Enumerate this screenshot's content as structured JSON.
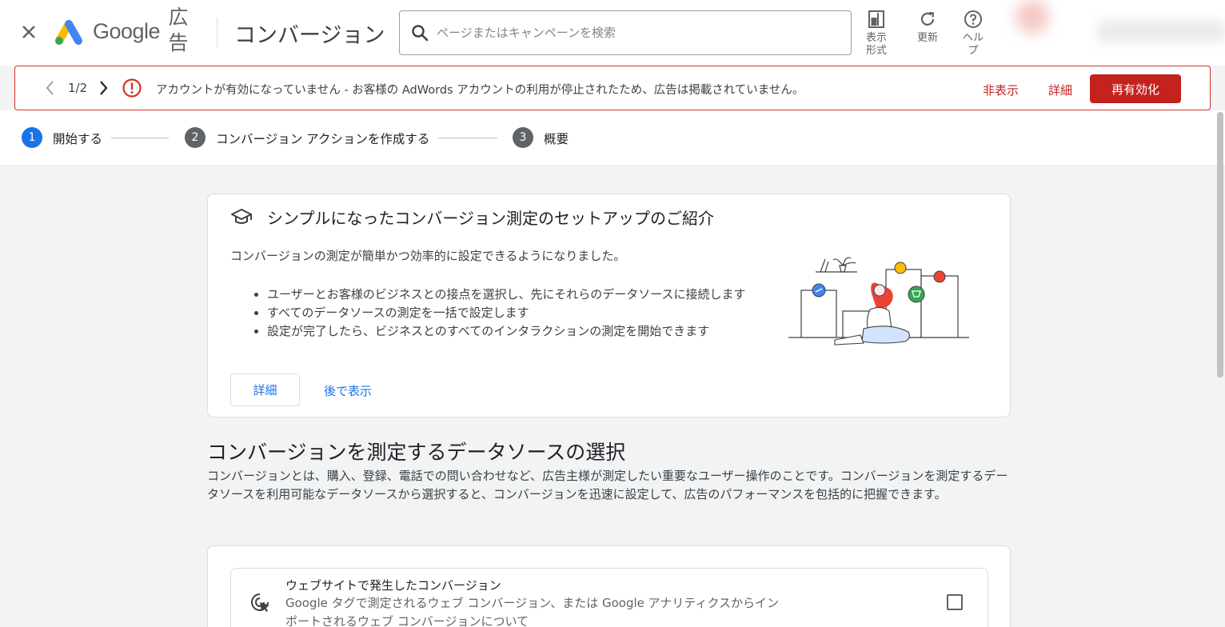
{
  "header": {
    "close_icon": "close-icon",
    "logo": "google-ads-logo",
    "brand": "Google",
    "product": "広告",
    "page_title": "コンバージョン",
    "search_placeholder": "ページまたはキャンペーンを検索",
    "tools": [
      {
        "icon": "appearance-icon",
        "label": "表示形式"
      },
      {
        "icon": "refresh-icon",
        "label": "更新"
      },
      {
        "icon": "help-icon",
        "label": "ヘルプ"
      }
    ]
  },
  "alert": {
    "counter": "1/2",
    "message": "アカウントが有効になっていません - お客様の AdWords アカウントの利用が停止されたため、広告は掲載されていません。",
    "dismiss_label": "非表示",
    "details_label": "詳細",
    "reactivate_label": "再有効化",
    "color": "#c5221f"
  },
  "stepper": {
    "steps": [
      {
        "number": "1",
        "label": "開始する",
        "active": true
      },
      {
        "number": "2",
        "label": "コンバージョン アクションを作成する",
        "active": false
      },
      {
        "number": "3",
        "label": "概要",
        "active": false
      }
    ],
    "active_color": "#1a73e8",
    "inactive_color": "#5f6368"
  },
  "intro_card": {
    "title": "シンプルになったコンバージョン測定のセットアップのご紹介",
    "description": "コンバージョンの測定が簡単かつ効率的に設定できるようになりました。",
    "bullets": [
      "ユーザーとお客様のビジネスとの接点を選択し、先にそれらのデータソースに接続します",
      "すべてのデータソースの測定を一括で設定します",
      "設定が完了したら、ビジネスとのすべてのインタラクションの測定を開始できます"
    ],
    "learn_more_label": "詳細",
    "later_label": "後で表示"
  },
  "data_sources": {
    "title": "コンバージョンを測定するデータソースの選択",
    "description": "コンバージョンとは、購入、登録、電話での問い合わせなど、広告主様が測定したい重要なユーザー操作のことです。コンバージョンを測定するデータソースを利用可能なデータソースから選択すると、コンバージョンを迅速に設定して、広告のパフォーマンスを包括的に把握できます。",
    "items": [
      {
        "icon": "cursor-click-icon",
        "title": "ウェブサイトで発生したコンバージョン",
        "description": "Google タグで測定されるウェブ コンバージョン、または Google アナリティクスからインポートされるウェブ コンバージョンについて",
        "checked": false
      }
    ]
  }
}
